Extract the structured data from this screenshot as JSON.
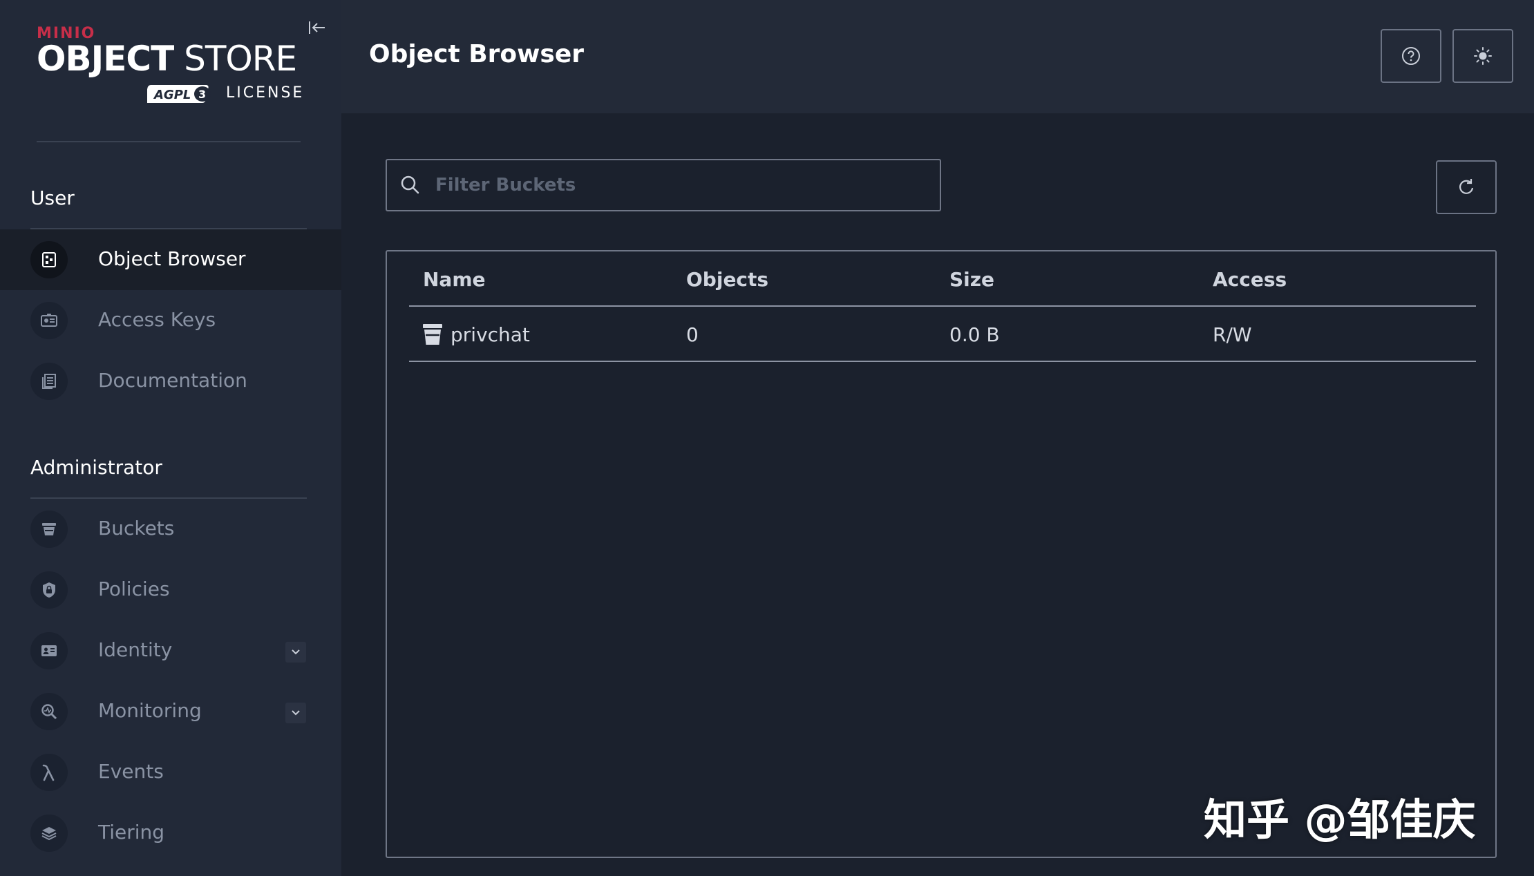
{
  "brand": {
    "minio": "MINIO",
    "product_bold": "OBJECT",
    "product_light": " STORE",
    "license_badge": "AGPLv3",
    "license_text": "LICENSE"
  },
  "sidebar": {
    "user_section": "User",
    "user_items": [
      {
        "label": "Object Browser",
        "icon": "object-browser-icon",
        "active": true
      },
      {
        "label": "Access Keys",
        "icon": "access-keys-icon"
      },
      {
        "label": "Documentation",
        "icon": "documentation-icon"
      }
    ],
    "admin_section": "Administrator",
    "admin_items": [
      {
        "label": "Buckets",
        "icon": "bucket-icon"
      },
      {
        "label": "Policies",
        "icon": "policy-shield-icon"
      },
      {
        "label": "Identity",
        "icon": "identity-card-icon",
        "expandable": true
      },
      {
        "label": "Monitoring",
        "icon": "monitoring-icon",
        "expandable": true
      },
      {
        "label": "Events",
        "icon": "lambda-icon"
      },
      {
        "label": "Tiering",
        "icon": "layers-icon"
      }
    ]
  },
  "header": {
    "title": "Object Browser",
    "help_icon": "help-circle-icon",
    "theme_icon": "sun-icon"
  },
  "search": {
    "placeholder": "Filter Buckets",
    "value": ""
  },
  "table": {
    "columns": [
      "Name",
      "Objects",
      "Size",
      "Access"
    ],
    "rows": [
      {
        "name": "privchat",
        "objects": "0",
        "size": "0.0 B",
        "access": "R/W"
      }
    ]
  },
  "watermark": "知乎 @邹佳庆",
  "colors": {
    "sidebar_bg": "#222938",
    "main_bg": "#1b212d",
    "header_bg": "#232a38",
    "brand_red": "#c72e49",
    "border": "#6f7686"
  }
}
